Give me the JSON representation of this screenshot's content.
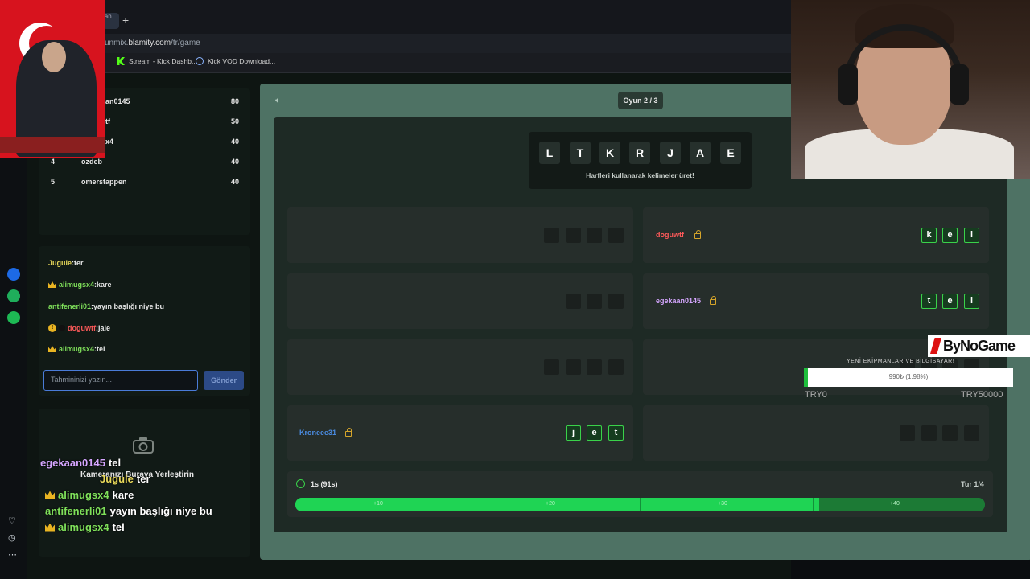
{
  "browser": {
    "tab_label": "lan",
    "new_tab": "+",
    "url_prefix": "unmix.",
    "url_domain": "blamity.com",
    "url_path": "/tr/game",
    "bookmarks": [
      {
        "label": "Stream - Kick Dashb...",
        "icon": "kick-icon"
      },
      {
        "label": "Kick VOD Download...",
        "icon": "download-icon"
      }
    ]
  },
  "leaderboard": {
    "rows": [
      {
        "rank": "",
        "name": "an0145",
        "score": "80"
      },
      {
        "rank": "",
        "name": "tf",
        "score": "50"
      },
      {
        "rank": "",
        "name": "x4",
        "score": "40"
      },
      {
        "rank": "4",
        "name": "ozdeb",
        "score": "40"
      },
      {
        "rank": "5",
        "name": "omerstappen",
        "score": "40"
      }
    ]
  },
  "chat": {
    "messages": [
      {
        "user": "Jugule",
        "text": ":ter",
        "color": "#e9d95a",
        "badge": "none"
      },
      {
        "user": "alimugsx4",
        "text": ":kare",
        "color": "#7fe05a",
        "badge": "crown"
      },
      {
        "user": "antifenerli01",
        "text": ":yayın başlığı niye bu",
        "color": "#7fe05a",
        "badge": "none"
      },
      {
        "user": "doguwtf",
        "text": ":jale",
        "color": "#ff5a5a",
        "badge": "warning"
      },
      {
        "user": "alimugsx4",
        "text": ":tel",
        "color": "#7fe05a",
        "badge": "crown"
      }
    ],
    "input_placeholder": "Tahmininizi yazın...",
    "send_label": "Gönder"
  },
  "camera": {
    "placeholder": "Kameranızı Buraya Yerleştirin",
    "icon": "camera-icon"
  },
  "overlay_chat": [
    {
      "user": "egekaan0145",
      "text": "tel",
      "color": "#d5a6ff",
      "badge": "none"
    },
    {
      "user": "Jugule",
      "text": "ter",
      "color": "#e9d95a",
      "badge": "none"
    },
    {
      "user": "alimugsx4",
      "text": "kare",
      "color": "#7fe05a",
      "badge": "crown"
    },
    {
      "user": "antifenerli01",
      "text": "yayın başlığı niye bu",
      "color": "#7fe05a",
      "badge": "none"
    },
    {
      "user": "alimugsx4",
      "text": "tel",
      "color": "#7fe05a",
      "badge": "crown"
    }
  ],
  "game": {
    "round_label": "Oyun 2 / 3",
    "letters": [
      "L",
      "T",
      "K",
      "R",
      "J",
      "A",
      "E"
    ],
    "hint": "Harfleri kullanarak kelimeler üret!",
    "slots_left": [
      {
        "owner": "",
        "letters": [],
        "boxes": 4
      },
      {
        "owner": "",
        "letters": [],
        "boxes": 3
      },
      {
        "owner": "",
        "letters": [],
        "boxes": 4
      },
      {
        "owner": "Kroneee31",
        "owner_color": "#4a8be0",
        "letters": [
          "j",
          "e",
          "t"
        ],
        "boxes": 3
      }
    ],
    "slots_right": [
      {
        "owner": "doguwtf",
        "owner_color": "#ff5a5a",
        "letters": [
          "k",
          "e",
          "l"
        ],
        "boxes": 3
      },
      {
        "owner": "egekaan0145",
        "owner_color": "#d5a6ff",
        "letters": [
          "t",
          "e",
          "l"
        ],
        "boxes": 3
      },
      {
        "owner": "",
        "letters": [],
        "boxes": 4
      },
      {
        "owner": "",
        "letters": [],
        "boxes": 4
      }
    ],
    "timer_text": "1s (91s)",
    "turn_text": "Tur 1/4",
    "progress_fraction": 0.76,
    "segments": [
      "+10",
      "+20",
      "+30",
      "+40"
    ]
  },
  "overlay": {
    "brand": "ByNoGame",
    "donation_title": "YENİ EKİPMANLAR VE BİLGİSAYAR!",
    "donation_value": "990₺ (1.98%)",
    "donation_fraction": 0.0198,
    "donation_min": "TRY0",
    "donation_max": "TRY50000"
  }
}
